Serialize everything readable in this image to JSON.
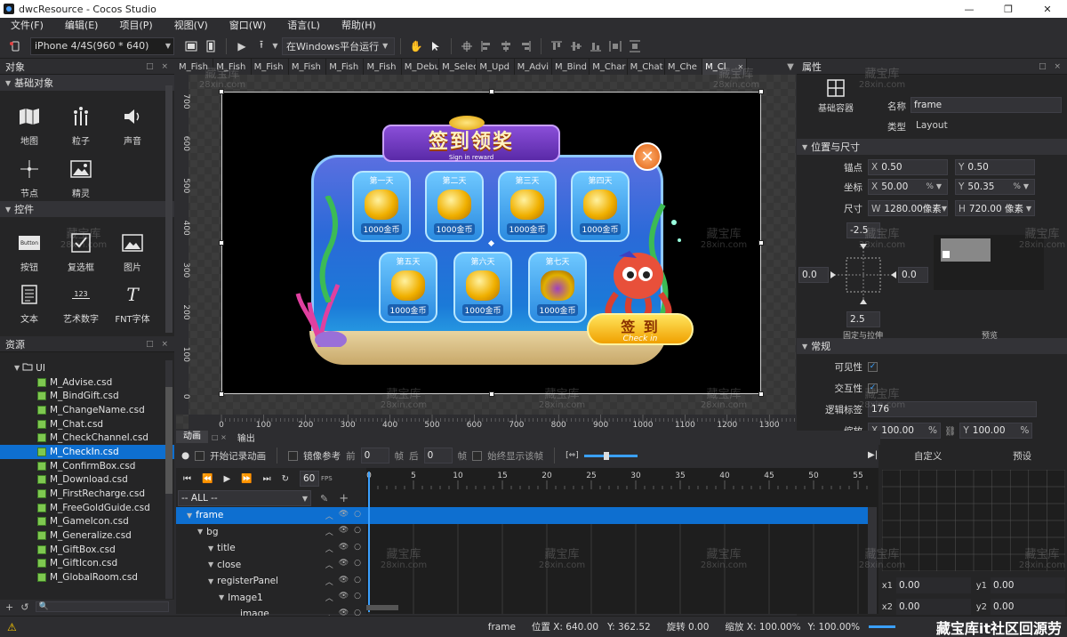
{
  "window": {
    "title": "dwcResource - Cocos Studio",
    "minimize": "—",
    "restore": "❐",
    "close": "✕"
  },
  "menu": [
    "文件(F)",
    "编辑(E)",
    "项目(P)",
    "视图(V)",
    "窗口(W)",
    "语言(L)",
    "帮助(H)"
  ],
  "toolbar": {
    "device": "iPhone 4/4S(960 * 640)",
    "run_target": "在Windows平台运行"
  },
  "objects_panel": {
    "title": "对象",
    "basic_section": "基础对象",
    "basic_items": [
      {
        "label": "地图",
        "icon": "map-icon"
      },
      {
        "label": "粒子",
        "icon": "particle-icon"
      },
      {
        "label": "声音",
        "icon": "sound-icon"
      },
      {
        "label": "节点",
        "icon": "node-icon"
      },
      {
        "label": "精灵",
        "icon": "sprite-icon"
      }
    ],
    "controls_section": "控件",
    "control_items": [
      {
        "label": "按钮",
        "icon": "button-icon",
        "glyph": "Button"
      },
      {
        "label": "复选框",
        "icon": "checkbox-icon"
      },
      {
        "label": "图片",
        "icon": "image-icon"
      },
      {
        "label": "文本",
        "icon": "text-icon"
      },
      {
        "label": "艺术数字",
        "icon": "art-number-icon",
        "glyph": "123"
      },
      {
        "label": "FNT字体",
        "icon": "fnt-font-icon",
        "glyph": "T"
      }
    ]
  },
  "resources_panel": {
    "title": "资源",
    "root": "UI",
    "files": [
      "M_Advise.csd",
      "M_BindGift.csd",
      "M_ChangeName.csd",
      "M_Chat.csd",
      "M_CheckChannel.csd",
      "M_CheckIn.csd",
      "M_ConfirmBox.csd",
      "M_Download.csd",
      "M_FirstRecharge.csd",
      "M_FreeGoldGuide.csd",
      "M_GameIcon.csd",
      "M_Generalize.csd",
      "M_GiftBox.csd",
      "M_GiftIcon.csd",
      "M_GlobalRoom.csd"
    ],
    "selected_index": 5
  },
  "doc_tabs": [
    "M_Fish",
    "M_Fish",
    "M_Fish",
    "M_Fish",
    "M_Fish",
    "M_Fish",
    "M_Debu",
    "M_Selec",
    "M_Upd",
    "M_Advi",
    "M_Bind",
    "M_Char",
    "M_Chat",
    "M_Che",
    "M_Cl"
  ],
  "canvas": {
    "ruler_h": [
      "0",
      "100",
      "200",
      "300",
      "400",
      "500",
      "600",
      "700",
      "800",
      "900",
      "1000",
      "1100",
      "1200",
      "1300"
    ],
    "ruler_v": [
      "700",
      "600",
      "500",
      "400",
      "300",
      "200",
      "100",
      "0"
    ]
  },
  "game_ui": {
    "banner_title": "签到领奖",
    "banner_subtitle": "Sign in reward",
    "days": [
      "第一天",
      "第二天",
      "第三天",
      "第四天",
      "第五天",
      "第六天",
      "第七天"
    ],
    "reward": "1000金币",
    "checkin_button": "签 到",
    "checkin_sub": "Check in"
  },
  "properties_panel": {
    "title": "属性",
    "container_label": "基础容器",
    "name_label": "名称",
    "name_value": "frame",
    "type_label": "类型",
    "type_value": "Layout",
    "section_position": "位置与尺寸",
    "anchor_label": "锚点",
    "anchor_x": "0.50",
    "anchor_y": "0.50",
    "pos_label": "坐标",
    "pos_x": "50.00",
    "pos_y": "50.35",
    "pos_unit": "%",
    "size_label": "尺寸",
    "size_w": "1280.00像素",
    "size_h": "720.00 像素",
    "margin_top": "-2.5",
    "margin_left": "0.0",
    "margin_right": "0.0",
    "margin_bottom": "2.5",
    "fixed_stretch": "固定与拉伸",
    "preview": "预览",
    "section_general": "常规",
    "visible_label": "可见性",
    "interactive_label": "交互性",
    "tag_label": "逻辑标签",
    "tag_value": "176",
    "scale_label": "缩放",
    "scale_x": "100.00",
    "scale_y": "100.00"
  },
  "animation_panel": {
    "tab_anim": "动画",
    "tab_output": "输出",
    "record_label": "开始记录动画",
    "onion_label": "镜像参考",
    "prev_label": "前",
    "prev_value": "0",
    "frames_unit": "帧",
    "next_label": "后",
    "next_value": "0",
    "always_show": "始终显示该帧",
    "fps_value": "60",
    "fps_label": "FPS",
    "filter": "-- ALL --",
    "ruler": [
      "0",
      "5",
      "10",
      "15",
      "20",
      "25",
      "30",
      "35",
      "40",
      "45",
      "50",
      "55"
    ],
    "tree": [
      {
        "label": "frame",
        "indent": 1,
        "selected": true
      },
      {
        "label": "bg",
        "indent": 2
      },
      {
        "label": "title",
        "indent": 3
      },
      {
        "label": "close",
        "indent": 3
      },
      {
        "label": "registerPanel",
        "indent": 3
      },
      {
        "label": "Image1",
        "indent": 4
      },
      {
        "label": "image",
        "indent": 5
      }
    ]
  },
  "curve_panel": {
    "custom": "自定义",
    "preset": "预设",
    "x1_label": "x1",
    "x1": "0.00",
    "y1_label": "y1",
    "y1": "0.00",
    "x2_label": "x2",
    "x2": "0.00",
    "y2_label": "y2",
    "y2": "0.00"
  },
  "status_bar": {
    "node": "frame",
    "position": "位置 X: 640.00",
    "position_y": "Y: 362.52",
    "rotation": "旋转 0.00",
    "scale": "缩放 X: 100.00%",
    "scale_y": "Y: 100.00%",
    "watermark": "藏宝库it社区回源劳"
  },
  "watermarks": {
    "cn": "藏宝库",
    "en": "28xin.com"
  },
  "colors": {
    "accent": "#0e6fd0",
    "bg": "#2d2d30",
    "panel": "#252526"
  }
}
